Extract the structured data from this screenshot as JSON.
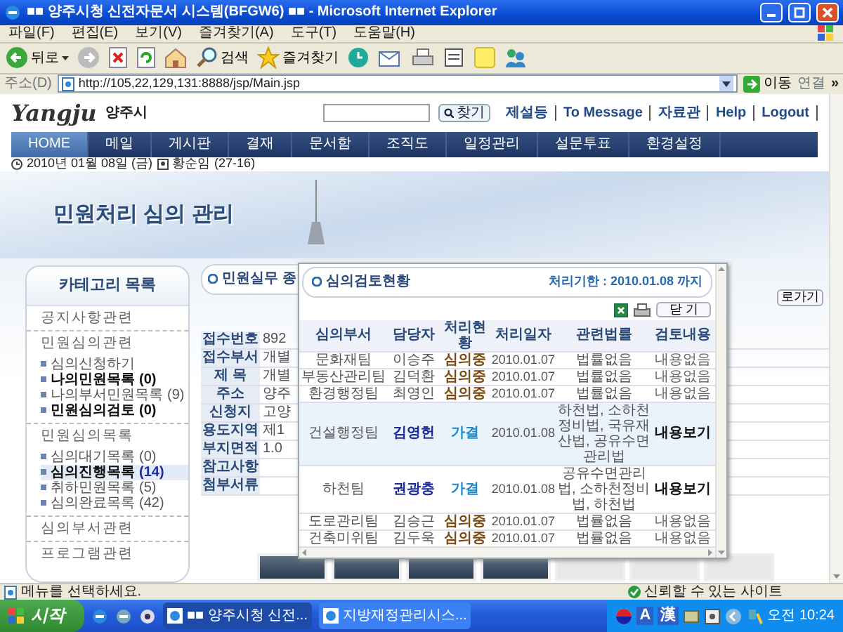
{
  "window": {
    "title": "■■ 양주시청 신전자문서 시스템(BFGW6) ■■ - Microsoft Internet Explorer"
  },
  "menu": [
    "파일(F)",
    "편집(E)",
    "보기(V)",
    "즐겨찾기(A)",
    "도구(T)",
    "도움말(H)"
  ],
  "toolbar": {
    "back": "뒤로",
    "search": "검색",
    "favorites": "즐겨찾기"
  },
  "address_bar": {
    "label": "주소(D)",
    "url": "http://105,22,129,131:8888/jsp/Main.jsp",
    "go": "이동",
    "links": "연결",
    "more": "»"
  },
  "site_header": {
    "logo": "Yangju",
    "city": "양주시",
    "search_button": "찾기",
    "links": [
      "제설등",
      "To Message",
      "자료관",
      "Help",
      "Logout"
    ]
  },
  "nav": [
    {
      "label": "HOME",
      "selected": true
    },
    {
      "label": "메일",
      "selected": false
    },
    {
      "label": "게시판",
      "selected": false
    },
    {
      "label": "결재",
      "selected": false
    },
    {
      "label": "문서함",
      "selected": false
    },
    {
      "label": "조직도",
      "selected": false
    },
    {
      "label": "일정관리",
      "selected": false
    },
    {
      "label": "설문투표",
      "selected": false
    },
    {
      "label": "환경설정",
      "selected": false
    }
  ],
  "date_line": {
    "date": "2010년 01월 08일 (금)",
    "user": "황순임",
    "extension": "(27-16)"
  },
  "banner": {
    "title": "민원처리 심의 관리"
  },
  "sidebar": {
    "title": "카테고리 목록",
    "groups": [
      {
        "heading": "공지사항관련"
      },
      {
        "heading": "민원심의관련",
        "items": [
          {
            "label": "심의신청하기",
            "emphasized": false,
            "selected": false
          },
          {
            "label": "나의민원목록",
            "count": "(0)",
            "emphasized": true,
            "selected": false
          },
          {
            "label": "나의부서민원목록",
            "count": "(9)",
            "emphasized": false,
            "selected": false
          },
          {
            "label": "민원심의검토",
            "count": "(0)",
            "emphasized": true,
            "selected": false
          }
        ]
      },
      {
        "heading": "민원심의목록",
        "items": [
          {
            "label": "심의대기목록",
            "count": "(0)",
            "emphasized": false,
            "selected": false
          },
          {
            "label": "심의진행목록",
            "count": "(14)",
            "emphasized": true,
            "selected": true
          },
          {
            "label": "취하민원목록",
            "count": "(5)",
            "emphasized": false,
            "selected": false
          },
          {
            "label": "심의완료목록",
            "count": "(42)",
            "emphasized": false,
            "selected": false
          }
        ]
      },
      {
        "heading": "심의부서관련"
      },
      {
        "heading": "프로그램관련"
      }
    ]
  },
  "request_form": {
    "title": "민원실무 종",
    "shortcut_button": "로가기",
    "fields": [
      {
        "label": "접수번호",
        "value": "892"
      },
      {
        "label": "접수부서",
        "value": "개별"
      },
      {
        "label": "제 목",
        "value": "개별"
      },
      {
        "label": "주소",
        "value": "양주"
      },
      {
        "label": "신청지",
        "value": "고양"
      },
      {
        "label": "용도지역",
        "value": "제1"
      },
      {
        "label": "부지면적",
        "value": "1.0"
      },
      {
        "label": "참고사항"
      },
      {
        "label": "첨부서류"
      }
    ]
  },
  "popup": {
    "title": "심의검토현황",
    "deadline": "처리기한 : 2010.01.08 까지",
    "close_button": "닫 기",
    "columns": [
      "심의부서",
      "담당자",
      "처리현황",
      "처리일자",
      "관련법률",
      "검토내용"
    ],
    "rows": [
      {
        "kind": "reviewing",
        "selected": false,
        "cells": [
          "문화재팀",
          "이승주",
          "심의중",
          "2010.01.07",
          "법률없음",
          "내용없음"
        ]
      },
      {
        "kind": "reviewing",
        "selected": false,
        "cells": [
          "부동산관리팀",
          "김덕환",
          "심의중",
          "2010.01.07",
          "법률없음",
          "내용없음"
        ]
      },
      {
        "kind": "reviewing",
        "selected": false,
        "cells": [
          "환경행정팀",
          "최영인",
          "심의중",
          "2010.01.07",
          "법률없음",
          "내용없음"
        ]
      },
      {
        "kind": "approved",
        "selected": true,
        "cells": [
          "건설행정팀",
          "김영헌",
          "가결",
          "2010.01.08",
          "하천법, 소하천정비법, 국유재산법, 공유수면관리법",
          "내용보기"
        ]
      },
      {
        "kind": "approved",
        "selected": false,
        "cells": [
          "하천팀",
          "권광충",
          "가결",
          "2010.01.08",
          "공유수면관리법, 소하천정비법, 하천법",
          "내용보기"
        ]
      },
      {
        "kind": "reviewing",
        "selected": false,
        "cells": [
          "도로관리팀",
          "김승근",
          "심의중",
          "2010.01.07",
          "법률없음",
          "내용없음"
        ]
      },
      {
        "kind": "reviewing",
        "selected": false,
        "cells": [
          "건축미위팀",
          "김두욱",
          "심의중",
          "2010.01.07",
          "법률없음",
          "내용없음"
        ]
      }
    ]
  },
  "status_bar": {
    "message": "메뉴를 선택하세요.",
    "zone": "신뢰할 수 있는 사이트"
  },
  "taskbar": {
    "start": "시작",
    "tasks": [
      {
        "label": "■■ 양주시청 신전...",
        "selected": true
      },
      {
        "label": "지방재정관리시스...",
        "selected": false
      }
    ],
    "ime": [
      "A",
      "漢"
    ],
    "clock": "오전 10:24"
  }
}
